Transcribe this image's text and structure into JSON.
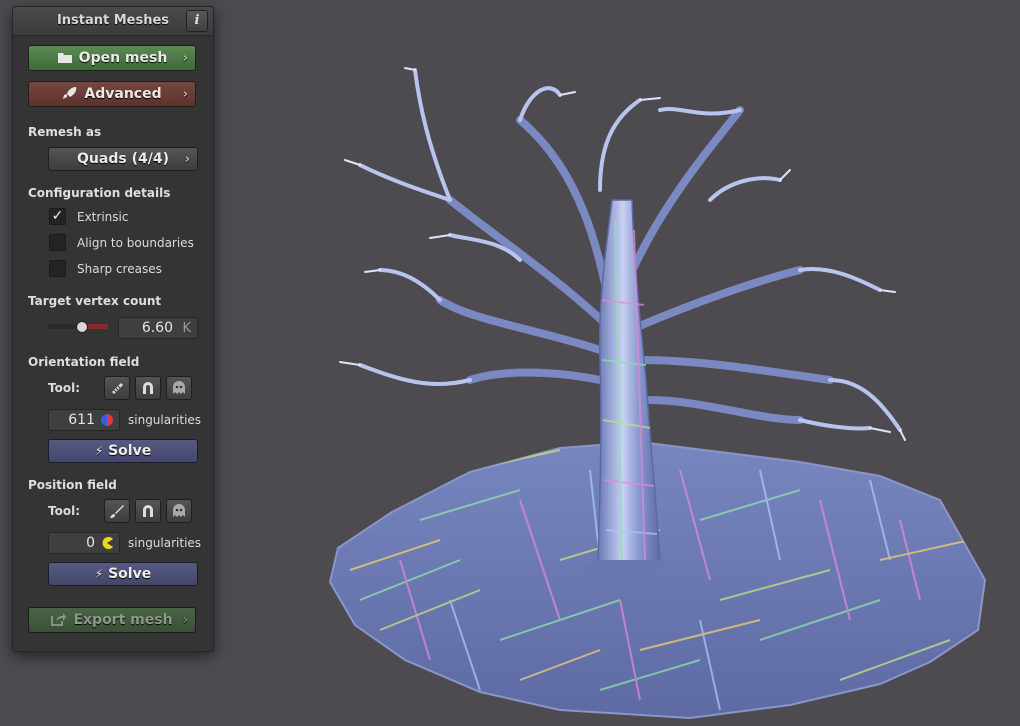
{
  "panel": {
    "title": "Instant Meshes",
    "info_label": "i",
    "open_mesh_label": "Open mesh",
    "advanced_label": "Advanced",
    "remesh_section": "Remesh as",
    "remesh_value": "Quads (4/4)",
    "config_section": "Configuration details",
    "checkboxes": [
      {
        "label": "Extrinsic",
        "checked": true,
        "mark": "✓"
      },
      {
        "label": "Align to boundaries",
        "checked": false,
        "mark": ""
      },
      {
        "label": "Sharp creases",
        "checked": false,
        "mark": ""
      }
    ],
    "target_section": "Target vertex count",
    "target_value": "6.60",
    "target_unit": "K",
    "target_slider_level": 0.55,
    "orientation_section": "Orientation field",
    "orientation_tool_label": "Tool:",
    "orientation_tools": [
      "comb-icon",
      "attractor-icon",
      "ghost-icon"
    ],
    "orientation_singularities": "611",
    "orientation_singularities_label": "singularities",
    "orientation_solve_label": "Solve",
    "position_section": "Position field",
    "position_tool_label": "Tool:",
    "position_tools": [
      "brush-icon",
      "attractor-icon",
      "ghost-icon"
    ],
    "position_singularities": "0",
    "position_singularities_label": "singularities",
    "position_solve_label": "Solve",
    "export_label": "Export mesh",
    "chevron": "›",
    "bolt": "⚡"
  },
  "colors": {
    "background": "#4d4b50",
    "mesh": "#6f7fb5",
    "open_button": "#4a7a44",
    "advanced_button": "#6a3a35",
    "solve_button": "#4e5178"
  }
}
